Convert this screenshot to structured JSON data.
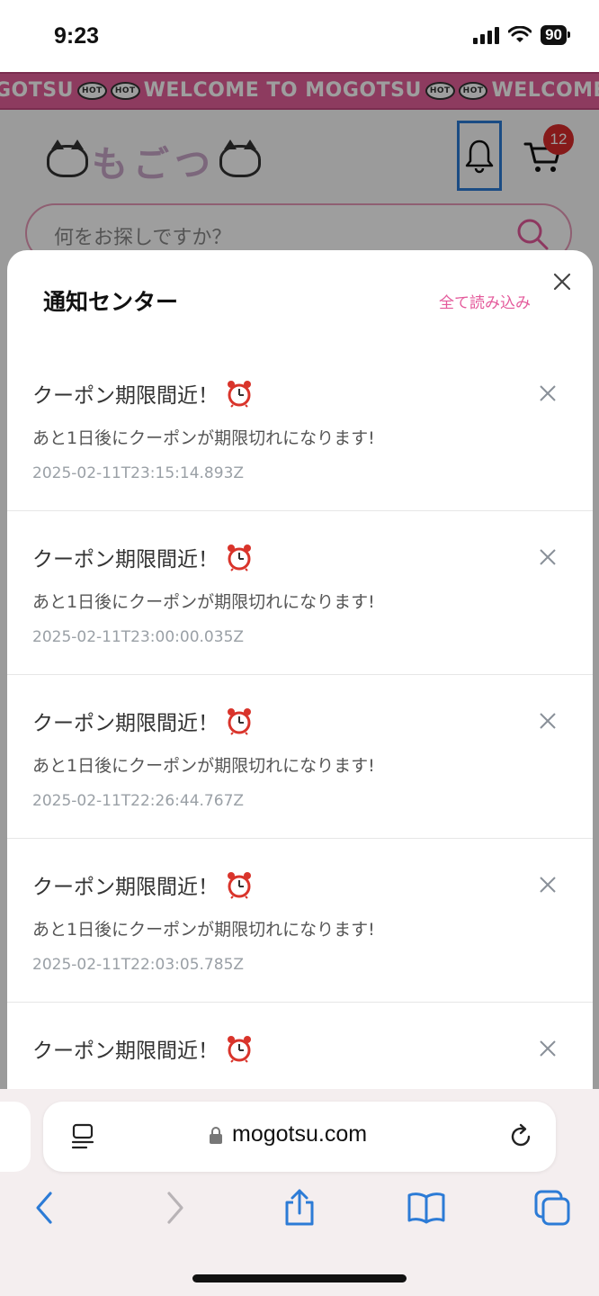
{
  "status_bar": {
    "time": "9:23",
    "battery": "90"
  },
  "site": {
    "marquee": {
      "segments": [
        "GOTSU",
        "WELCOME TO MOGOTSU",
        "WELCOME TO MOGOTSU"
      ],
      "hot_label": "HOT"
    },
    "logo_text": "もごつ",
    "cart_count": "12",
    "search_placeholder": "何をお探しですか？"
  },
  "notification_center": {
    "title": "通知センター",
    "read_all_label": "全て読み込み",
    "items": [
      {
        "title": "クーポン期限間近！",
        "body": "あと1日後にクーポンが期限切れになります!",
        "time": "2025-02-11T23:15:14.893Z"
      },
      {
        "title": "クーポン期限間近！",
        "body": "あと1日後にクーポンが期限切れになります!",
        "time": "2025-02-11T23:00:00.035Z"
      },
      {
        "title": "クーポン期限間近！",
        "body": "あと1日後にクーポンが期限切れになります!",
        "time": "2025-02-11T22:26:44.767Z"
      },
      {
        "title": "クーポン期限間近！",
        "body": "あと1日後にクーポンが期限切れになります!",
        "time": "2025-02-11T22:03:05.785Z"
      },
      {
        "title": "クーポン期限間近！",
        "body": "",
        "time": ""
      }
    ]
  },
  "browser": {
    "url": "mogotsu.com"
  },
  "colors": {
    "accent": "#e45a9b",
    "marquee": "#e4609a",
    "badge": "#d92a2a",
    "ios_blue": "#2c7bd6"
  }
}
